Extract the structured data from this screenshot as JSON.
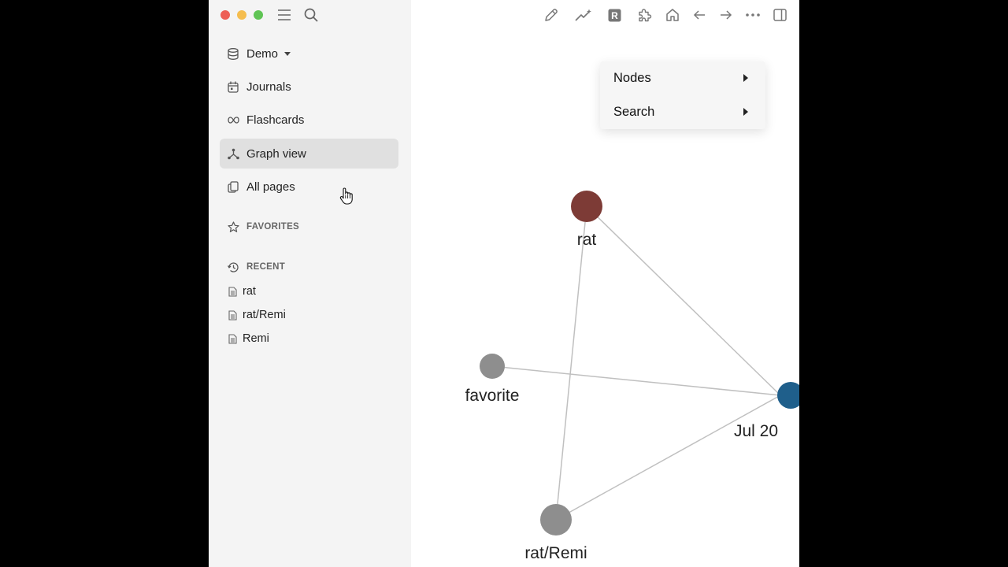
{
  "sidebar": {
    "graph_name": "Demo",
    "nav": [
      {
        "label": "Journals",
        "icon": "calendar-icon"
      },
      {
        "label": "Flashcards",
        "icon": "infinity-icon"
      },
      {
        "label": "Graph view",
        "icon": "graph-icon",
        "active": true
      },
      {
        "label": "All pages",
        "icon": "pages-icon"
      }
    ],
    "favorites_label": "FAVORITES",
    "recent_label": "RECENT",
    "recent": [
      "rat",
      "rat/Remi",
      "Remi"
    ]
  },
  "menu": {
    "items": [
      "Nodes",
      "Search"
    ]
  },
  "graph": {
    "nodes": [
      {
        "label": "rat",
        "color": "#7d3b36"
      },
      {
        "label": "favorite",
        "color": "#8e8e8e"
      },
      {
        "label": "Jul 20",
        "color": "#1f5f8b"
      },
      {
        "label": "rat/Remi",
        "color": "#8e8e8e"
      }
    ]
  },
  "colors": {
    "sidebar_bg": "#f4f4f4",
    "active_item_bg": "#e0e0e0",
    "edge": "#c0c0c0"
  }
}
